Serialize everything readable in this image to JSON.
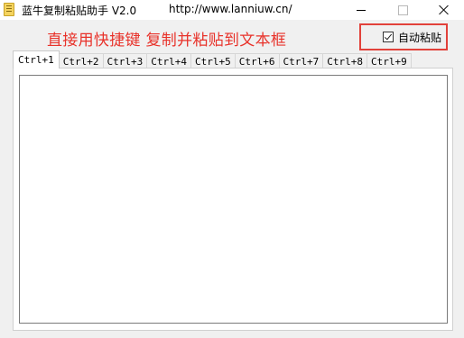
{
  "window": {
    "title": "蓝牛复制粘贴助手 V2.0",
    "url": "http://www.lanniuw.cn/"
  },
  "controls": {
    "minimize": "minimize-icon",
    "maximize": "maximize-icon",
    "close": "close-icon"
  },
  "instruction_text": "直接用快捷键 复制并粘贴到文本框",
  "auto_paste": {
    "label": "自动粘贴",
    "checked": true
  },
  "tabs": [
    {
      "label": "Ctrl+1",
      "active": true
    },
    {
      "label": "Ctrl+2",
      "active": false
    },
    {
      "label": "Ctrl+3",
      "active": false
    },
    {
      "label": "Ctrl+4",
      "active": false
    },
    {
      "label": "Ctrl+5",
      "active": false
    },
    {
      "label": "Ctrl+6",
      "active": false
    },
    {
      "label": "Ctrl+7",
      "active": false
    },
    {
      "label": "Ctrl+8",
      "active": false
    },
    {
      "label": "Ctrl+9",
      "active": false
    }
  ],
  "textbox_value": "",
  "colors": {
    "instruction": "#e8322a",
    "highlight_border": "#e2413a"
  }
}
